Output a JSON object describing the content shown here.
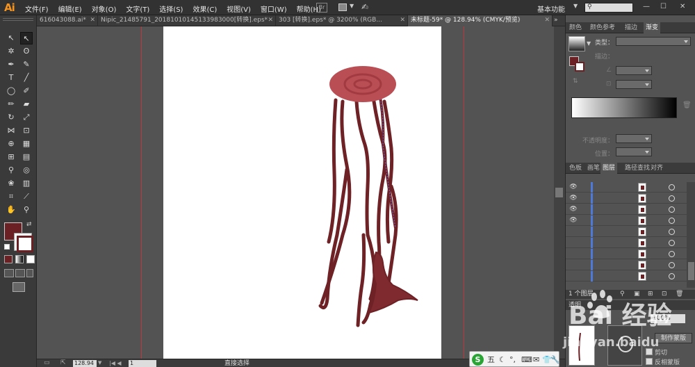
{
  "app": {
    "logo": "Ai",
    "menus": [
      "文件(F)",
      "编辑(E)",
      "对象(O)",
      "文字(T)",
      "选择(S)",
      "效果(C)",
      "视图(V)",
      "窗口(W)",
      "帮助(H)"
    ],
    "bridge_label": "Br",
    "workspace": "基本功能",
    "window_controls": [
      "—",
      "☐",
      "✕"
    ]
  },
  "tabs": [
    {
      "label": "616043088.ai*",
      "active": false
    },
    {
      "label": "Nipic_21485791_20181010145133983000[转换].eps*",
      "active": false
    },
    {
      "label": "303 [转换].eps* @ 3200% (RGB...",
      "active": false
    },
    {
      "label": "未标题-59* @ 128.94% (CMYK/预览)",
      "active": true
    }
  ],
  "tab_close": "✕",
  "tab_more": "»",
  "toolbar": {
    "tools": [
      {
        "name": "selection-tool-icon",
        "glyph": "↖"
      },
      {
        "name": "direct-selection-tool-icon",
        "glyph": "↖"
      },
      {
        "name": "magic-wand-tool-icon",
        "glyph": "✲"
      },
      {
        "name": "lasso-tool-icon",
        "glyph": "ʘ"
      },
      {
        "name": "pen-tool-icon",
        "glyph": "✒"
      },
      {
        "name": "curvature-tool-icon",
        "glyph": "✎"
      },
      {
        "name": "type-tool-icon",
        "glyph": "T"
      },
      {
        "name": "line-tool-icon",
        "glyph": "╱"
      },
      {
        "name": "ellipse-tool-icon",
        "glyph": "◯"
      },
      {
        "name": "paintbrush-tool-icon",
        "glyph": "✐"
      },
      {
        "name": "pencil-tool-icon",
        "glyph": "✏"
      },
      {
        "name": "eraser-tool-icon",
        "glyph": "▰"
      },
      {
        "name": "rotate-tool-icon",
        "glyph": "↻"
      },
      {
        "name": "scale-tool-icon",
        "glyph": "⤢"
      },
      {
        "name": "width-tool-icon",
        "glyph": "⋈"
      },
      {
        "name": "free-transform-tool-icon",
        "glyph": "⊡"
      },
      {
        "name": "shape-builder-tool-icon",
        "glyph": "⊕"
      },
      {
        "name": "perspective-grid-tool-icon",
        "glyph": "▦"
      },
      {
        "name": "mesh-tool-icon",
        "glyph": "⊞"
      },
      {
        "name": "gradient-tool-icon",
        "glyph": "▤"
      },
      {
        "name": "eyedropper-tool-icon",
        "glyph": "⚲"
      },
      {
        "name": "blend-tool-icon",
        "glyph": "◎"
      },
      {
        "name": "symbol-sprayer-tool-icon",
        "glyph": "❀"
      },
      {
        "name": "column-graph-tool-icon",
        "glyph": "▥"
      },
      {
        "name": "artboard-tool-icon",
        "glyph": "⌗"
      },
      {
        "name": "slice-tool-icon",
        "glyph": "⟋"
      },
      {
        "name": "hand-tool-icon",
        "glyph": "✋"
      },
      {
        "name": "zoom-tool-icon",
        "glyph": "⚲"
      }
    ],
    "fill_color": "#6b2024",
    "stroke_color": "#6b2024"
  },
  "canvas": {
    "artboard_color": "#ffffff",
    "guide_color": "#b83a3a",
    "art_fill": "#6e2226",
    "stump_top_outer": "#b94f55",
    "stump_top_inner": "#a23a41",
    "selection_color": "#6f6fe8"
  },
  "status": {
    "zoom": "128.94",
    "zoom_arrow": "▼",
    "nav_left": "|◀ ◀",
    "page": "1",
    "tool_name": "直接选择"
  },
  "right_panel": {
    "color_tabs": [
      {
        "label": "颜色",
        "active": false
      },
      {
        "label": "颜色参考",
        "active": false
      },
      {
        "label": "描边",
        "active": false
      },
      {
        "label": "渐变",
        "active": true
      }
    ],
    "gradient": {
      "type_label": "类型：",
      "stroke_label": "描边：",
      "opacity_label": "不透明度：",
      "position_label": "位置："
    },
    "layer_tabs": [
      {
        "label": "色板",
        "active": false
      },
      {
        "label": "画笔",
        "active": false
      },
      {
        "label": "图层",
        "active": true
      },
      {
        "label": "路径查找",
        "active": false
      },
      {
        "label": "对齐",
        "active": false
      }
    ],
    "layers": [
      {
        "visible": true,
        "eye": "👁"
      },
      {
        "visible": true,
        "eye": "👁"
      },
      {
        "visible": true,
        "eye": "👁"
      },
      {
        "visible": true,
        "eye": "👁"
      },
      {
        "visible": false,
        "eye": ""
      },
      {
        "visible": false,
        "eye": ""
      },
      {
        "visible": false,
        "eye": ""
      },
      {
        "visible": false,
        "eye": ""
      },
      {
        "visible": false,
        "eye": ""
      }
    ],
    "layer_count": "1 个图层",
    "transparency_label": "透明",
    "opacity_value": "100%",
    "make_mask": "制作蒙版",
    "clip": "剪切",
    "invert_mask": "反相蒙版"
  },
  "watermark": {
    "main": "Bai 经验",
    "sub": "jingyan.baidu"
  },
  "ime": {
    "logo": "S",
    "labels": [
      "五",
      "☾",
      "°,",
      "⌨",
      "✉",
      "👕",
      "🔧"
    ]
  }
}
